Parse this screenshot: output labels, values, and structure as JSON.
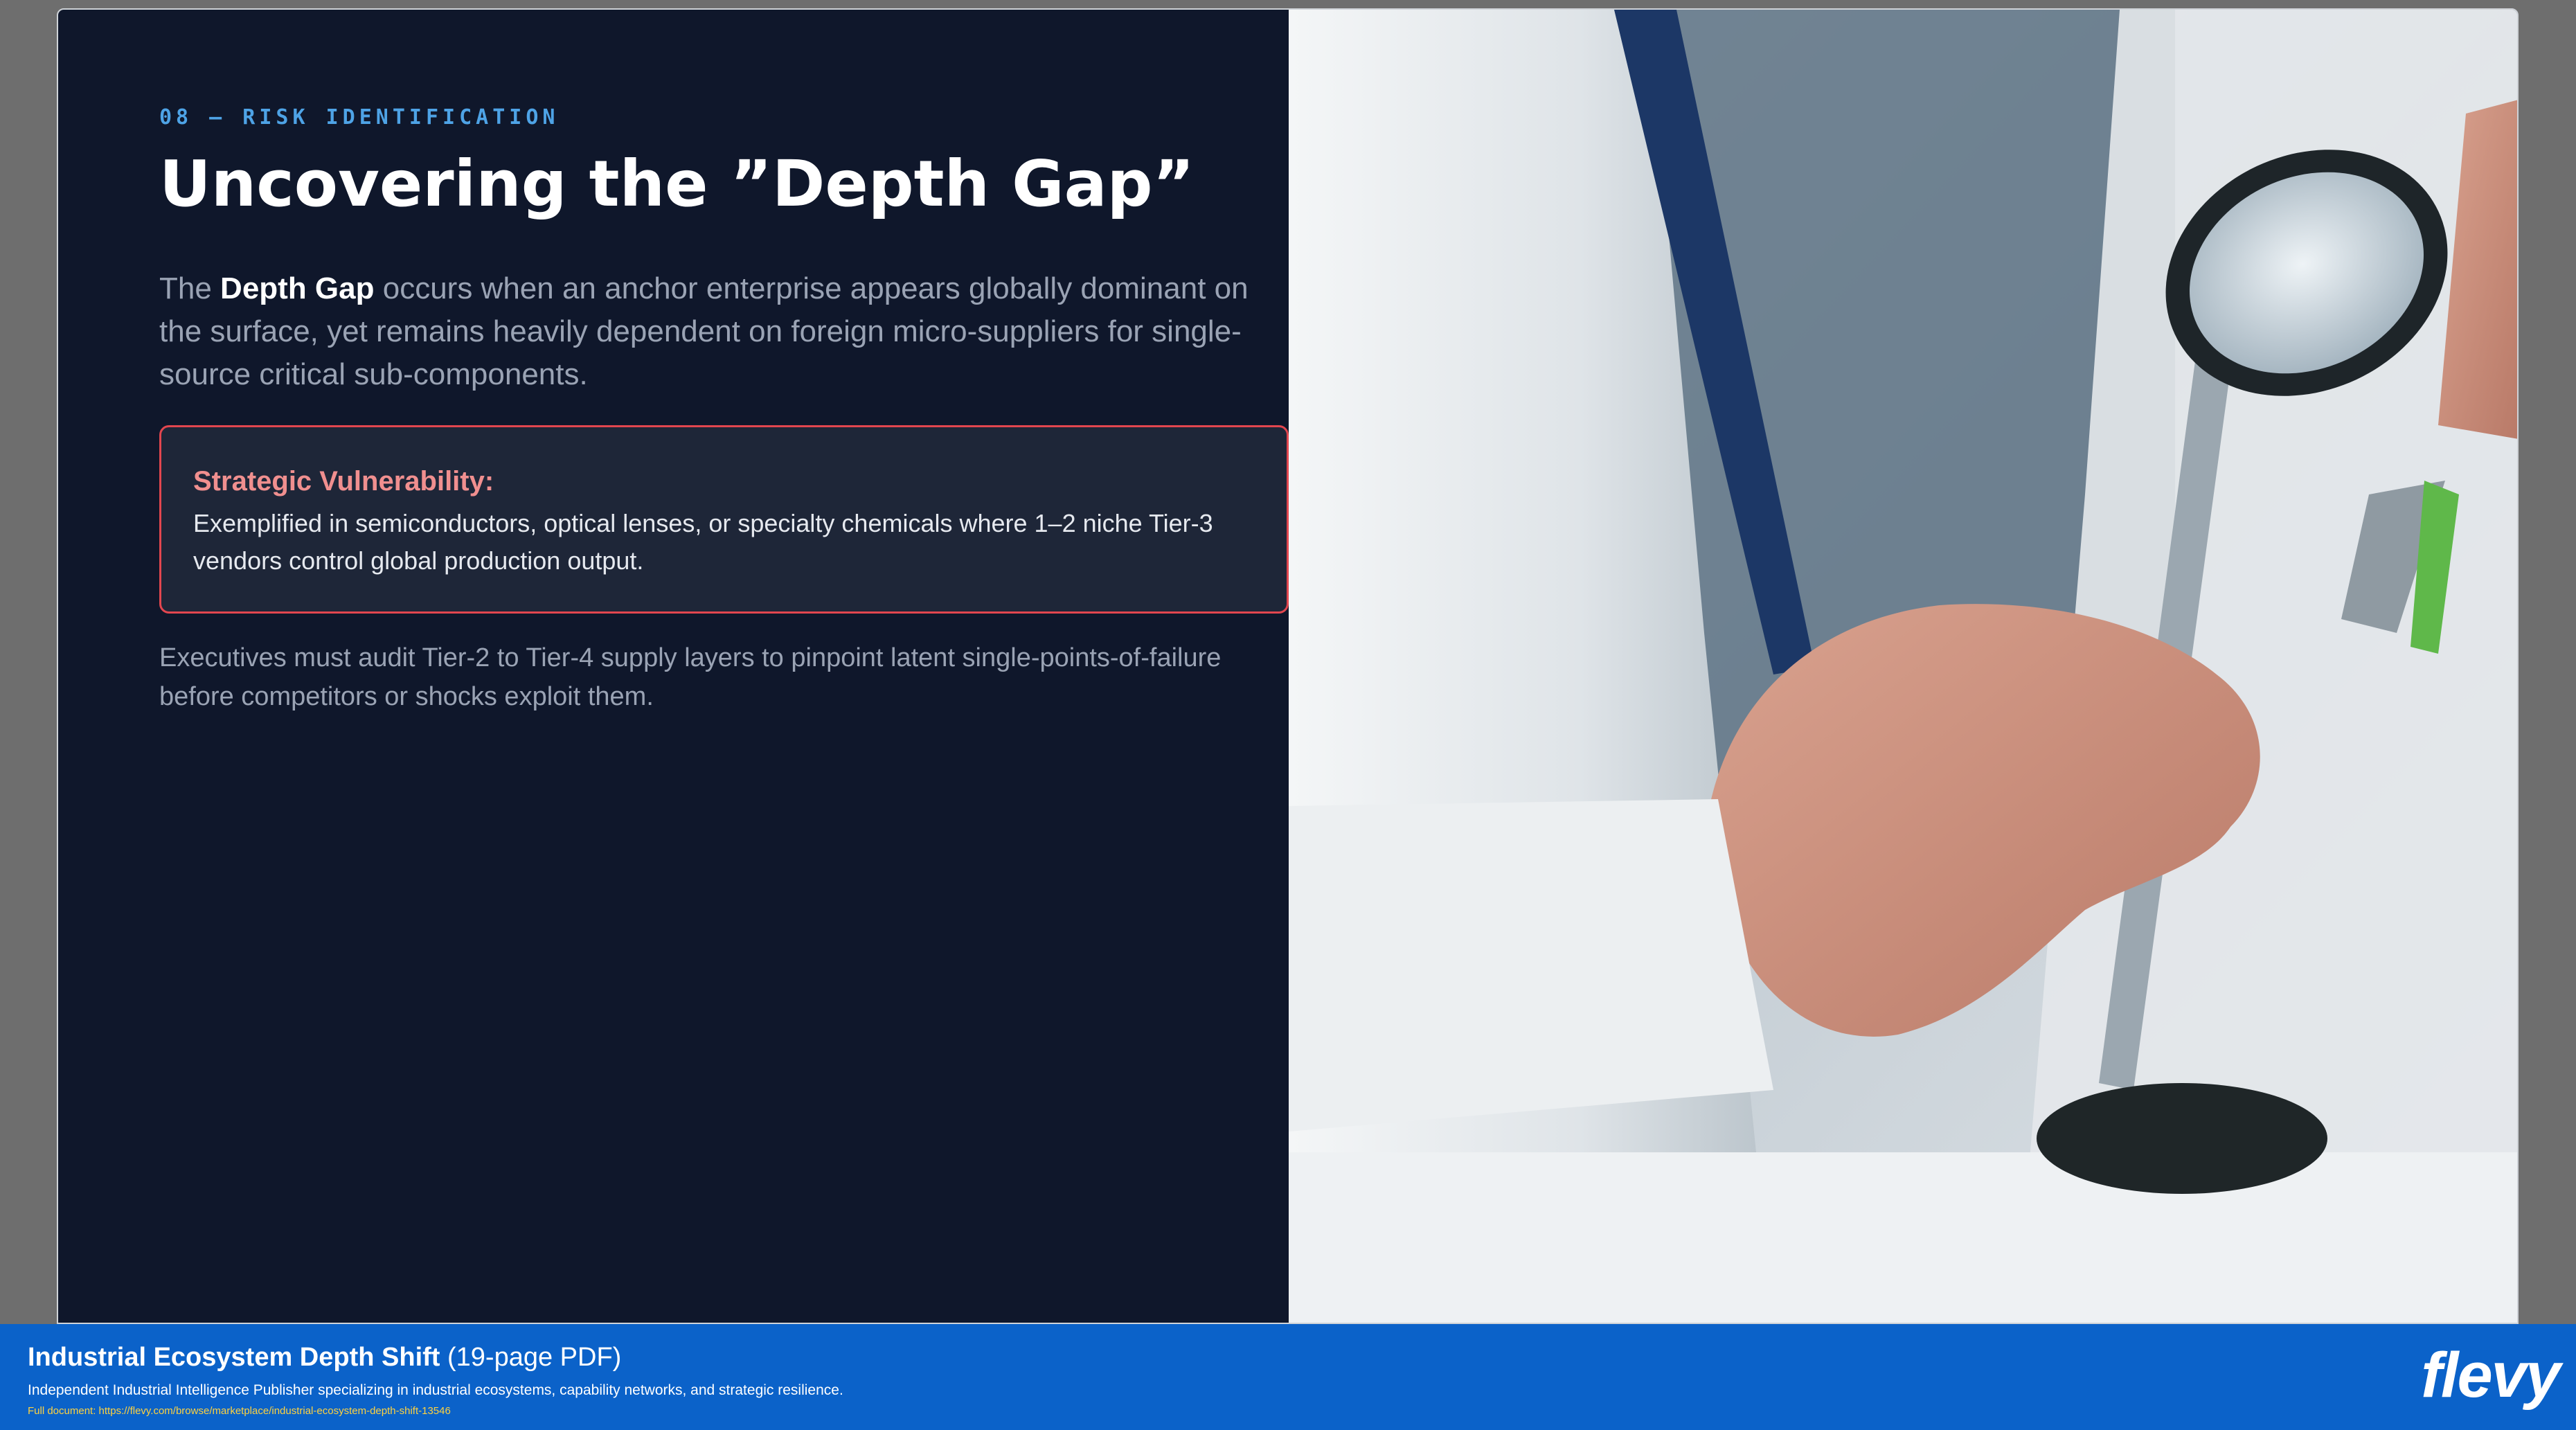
{
  "slide": {
    "eyebrow": "08 — RISK IDENTIFICATION",
    "title": "Uncovering the ”Depth Gap”",
    "intro": {
      "prefix": "The ",
      "bold": "Depth Gap",
      "suffix": " occurs when an anchor enterprise appears globally dominant on the surface, yet remains heavily dependent on foreign micro-suppliers for single-source critical sub-components."
    },
    "callout": {
      "title": "Strategic Vulnerability:",
      "body": "Exemplified in semiconductors, optical lenses, or specialty chemicals where 1–2 niche Tier-3 vendors control global production output."
    },
    "closing": "Executives must audit Tier-2 to Tier-4 supply layers to pinpoint latent single-points-of-failure before competitors or shocks exploit them."
  },
  "colors": {
    "slide_background": "#0f172b",
    "eyebrow": "#4ea3e6",
    "callout_border": "#e2464f",
    "callout_title": "#f08f8f",
    "footer_background": "#0b62c9",
    "footer_link": "#ffd23f"
  },
  "footer": {
    "title": "Industrial Ecosystem Depth Shift",
    "pages": " (19-page PDF)",
    "description": "Independent Industrial Intelligence Publisher specializing in industrial ecosystems, capability networks, and strategic resilience.",
    "link": "Full document: https://flevy.com/browse/marketplace/industrial-ecosystem-depth-shift-13546",
    "logo": "flevy"
  }
}
